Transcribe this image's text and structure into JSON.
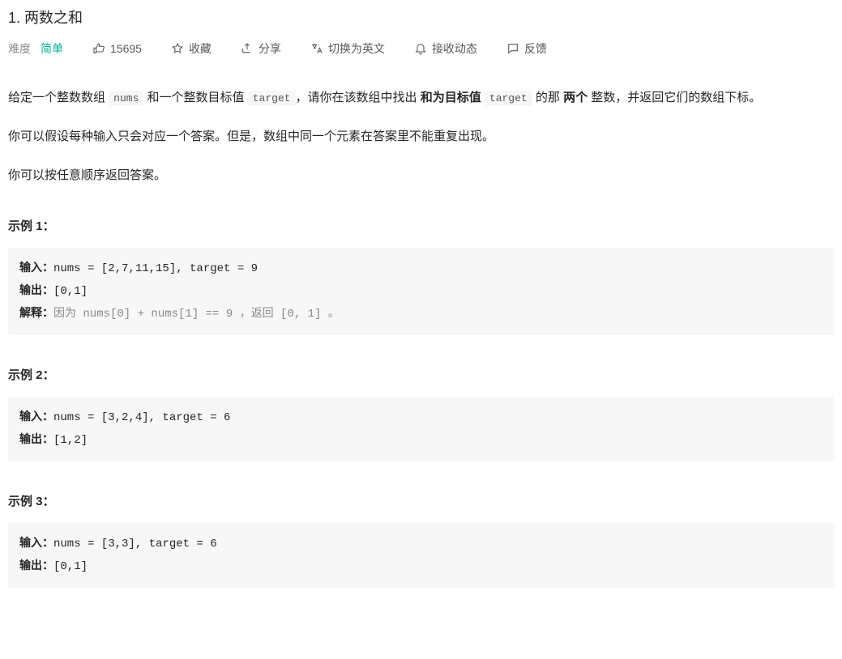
{
  "title": "1. 两数之和",
  "meta": {
    "difficulty_label": "难度",
    "difficulty_value": "简单",
    "likes": "15695",
    "favorite": "收藏",
    "share": "分享",
    "switch_lang": "切换为英文",
    "subscribe": "接收动态",
    "feedback": "反馈"
  },
  "desc": {
    "p1_a": "给定一个整数数组 ",
    "p1_code1": "nums",
    "p1_b": " 和一个整数目标值 ",
    "p1_code2": "target",
    "p1_c": "，请你在该数组中找出 ",
    "p1_bold1": "和为目标值",
    "p1_space1": " ",
    "p1_code3": "target",
    "p1_d": "  的那 ",
    "p1_bold2": "两个",
    "p1_e": " 整数，并返回它们的数组下标。",
    "p2": "你可以假设每种输入只会对应一个答案。但是，数组中同一个元素在答案里不能重复出现。",
    "p3": "你可以按任意顺序返回答案。"
  },
  "ex_label_input": "输入：",
  "ex_label_output": "输出：",
  "ex_label_explain": "解释：",
  "examples": [
    {
      "heading": "示例 1：",
      "input": "nums = [2,7,11,15], target = 9",
      "output": "[0,1]",
      "explain_a": "因为 nums[0] + nums[1] == 9 ，",
      "explain_dim": "返回",
      "explain_b": " [0, 1] 。"
    },
    {
      "heading": "示例 2：",
      "input": "nums = [3,2,4], target = 6",
      "output": "[1,2]"
    },
    {
      "heading": "示例 3：",
      "input": "nums = [3,3], target = 6",
      "output": "[0,1]"
    }
  ]
}
